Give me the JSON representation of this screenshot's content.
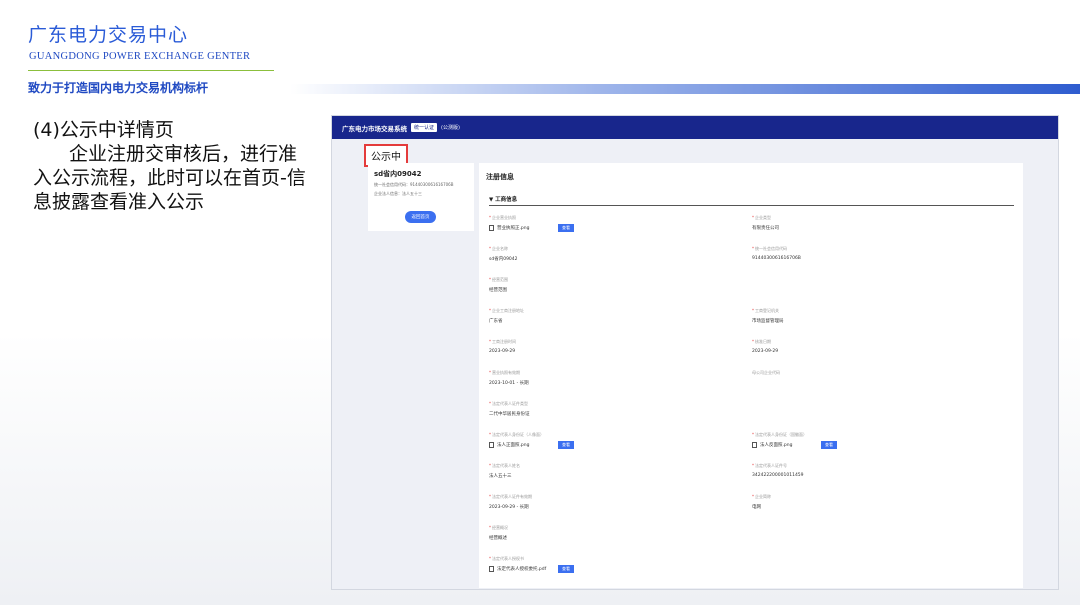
{
  "slide": {
    "org_name_cn": "广东电力交易中心",
    "org_name_en": "GUANGDONG POWER EXCHANGE GENTER",
    "slogan": "致力于打造国内电力交易机构标杆",
    "heading": "(4)公示中详情页",
    "description": "企业注册交审核后，进行准入公示流程，此时可以在首页-信息披露查看准入公示"
  },
  "app": {
    "nav_title": "广东电力市场交易系统",
    "nav_badge": "统一认证",
    "nav_pill": "(公测版)",
    "status_label": "公示中",
    "company_card": {
      "name": "sd省内09042",
      "credit_code": "统一社会信用代码：9144030061616706B",
      "legal_person": "企业法人信息：法人五十三",
      "back_label": "返回首页"
    },
    "main": {
      "title": "注册信息",
      "section": "▼ 工商信息",
      "view_label": "查看",
      "fields": {
        "biz_license": {
          "label": "企业营业执照",
          "file": "营业执照正.png"
        },
        "company_type": {
          "label": "企业类型",
          "value": "有限责任公司"
        },
        "company_name": {
          "label": "企业名称",
          "value": "sd省内09042"
        },
        "credit_code": {
          "label": "统一社会信用代码",
          "value": "9144030061616706B"
        },
        "biz_scope": {
          "label": "经营范围",
          "value": "经营范围"
        },
        "reg_address": {
          "label": "企业工商注册地址",
          "value": "广东省"
        },
        "reg_authority": {
          "label": "工商登记机关",
          "value": "市场监督管理局"
        },
        "reg_date": {
          "label": "工商注册时间",
          "value": "2023-09-29"
        },
        "approve_date": {
          "label": "核准日期",
          "value": "2023-09-29"
        },
        "biz_term": {
          "label": "营业执照有效期",
          "value": "2023-10-01 - 长期"
        },
        "parent_code": {
          "label": "母公司企业代码",
          "value": ""
        },
        "legal_id_type": {
          "label": "法定代表人证件类型",
          "value": "二代中华居民身份证"
        },
        "legal_id_front": {
          "label": "法定代表人身份证（人像面）",
          "file": "法人正面照.png"
        },
        "legal_id_back": {
          "label": "法定代表人身份证（国徽面）",
          "file": "法人反面照.png"
        },
        "legal_name": {
          "label": "法定代表人姓名",
          "value": "法人五十三"
        },
        "legal_id_no": {
          "label": "法定代表人证件号",
          "value": "342422200001011459"
        },
        "legal_id_term": {
          "label": "法定代表人证件有效期",
          "value": "2023-09-29 - 长期"
        },
        "biz_status": {
          "label": "企业简称",
          "value": "电网"
        },
        "brief": {
          "label": "经营概况",
          "value": "经营概述"
        },
        "auth_letter": {
          "label": "法定代表人授权书",
          "file": "法定代表人授权委托.pdf"
        }
      }
    }
  }
}
